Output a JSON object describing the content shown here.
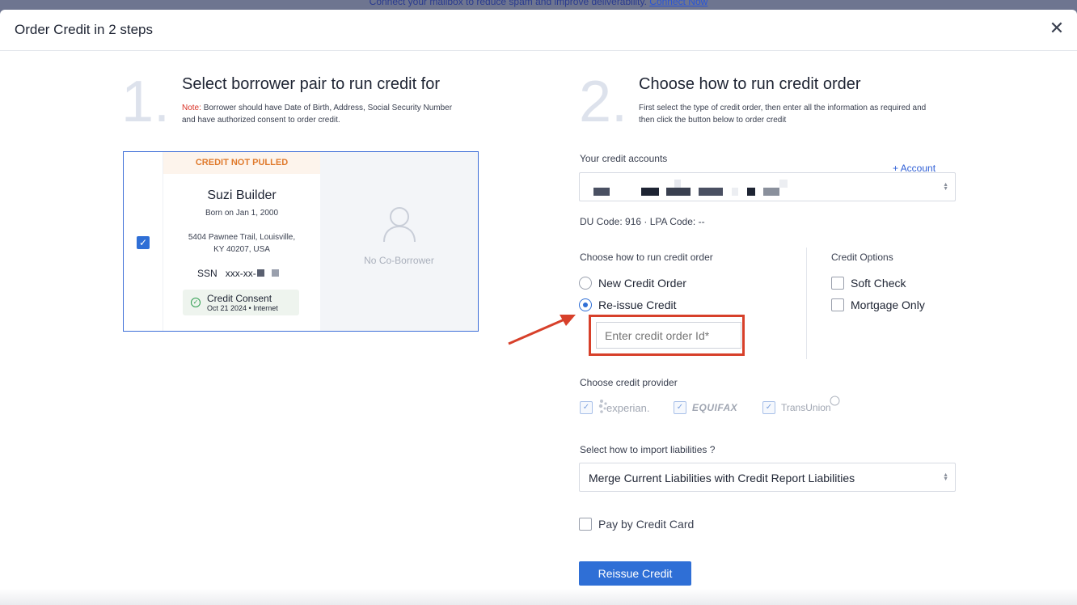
{
  "banner": {
    "text": "Connect your mailbox to reduce spam and improve deliverability.",
    "link": "Connect Now"
  },
  "modal": {
    "title": "Order Credit in 2 steps",
    "close_glyph": "✕"
  },
  "step1": {
    "number": "1.",
    "title": "Select borrower pair to run credit for",
    "note_label": "Note:",
    "note_line1": "Borrower should have Date of Birth, Address, Social Security Number",
    "note_line2": "and have authorized consent to order credit."
  },
  "borrower": {
    "selected": true,
    "status": "CREDIT NOT PULLED",
    "name": "Suzi Builder",
    "born": "Born on Jan 1, 2000",
    "address_line1": "5404 Pawnee Trail, Louisville,",
    "address_line2": "KY 40207, USA",
    "ssn_label": "SSN",
    "ssn_value": "xxx-xx-",
    "consent_title": "Credit Consent",
    "consent_date": "Oct 21 2024 • Internet",
    "coborrower_text": "No Co-Borrower"
  },
  "step2": {
    "number": "2.",
    "title": "Choose how to run credit order",
    "desc_line1": "First select the type of credit order, then enter all the information as required and",
    "desc_line2": "then click the button below to order credit"
  },
  "accounts": {
    "label": "Your credit accounts",
    "add_label": "+ Account",
    "du_label": "DU Code:",
    "du_value": "916",
    "separator": "·",
    "lpa_label": "LPA Code:",
    "lpa_value": "--"
  },
  "run_order": {
    "label": "Choose how to run credit order",
    "options": [
      {
        "label": "New Credit Order",
        "selected": false
      },
      {
        "label": "Re-issue Credit",
        "selected": true
      }
    ],
    "order_id_placeholder": "Enter credit order Id*"
  },
  "credit_options": {
    "label": "Credit Options",
    "options": [
      {
        "label": "Soft Check",
        "checked": false
      },
      {
        "label": "Mortgage Only",
        "checked": false
      }
    ]
  },
  "provider": {
    "label": "Choose credit provider",
    "items": [
      {
        "name": "experian.",
        "checked": true
      },
      {
        "name": "EQUIFAX",
        "checked": true
      },
      {
        "name": "TransUnion",
        "checked": true
      }
    ]
  },
  "liabilities": {
    "label": "Select how to import liabilities ?",
    "selected": "Merge Current Liabilities with Credit Report Liabilities"
  },
  "pay": {
    "label": "Pay by Credit Card",
    "checked": false
  },
  "submit": {
    "label": "Reissue Credit"
  },
  "colors": {
    "primary": "#2f6fd6",
    "highlight": "#d7402a",
    "status_orange": "#e07b2e"
  }
}
